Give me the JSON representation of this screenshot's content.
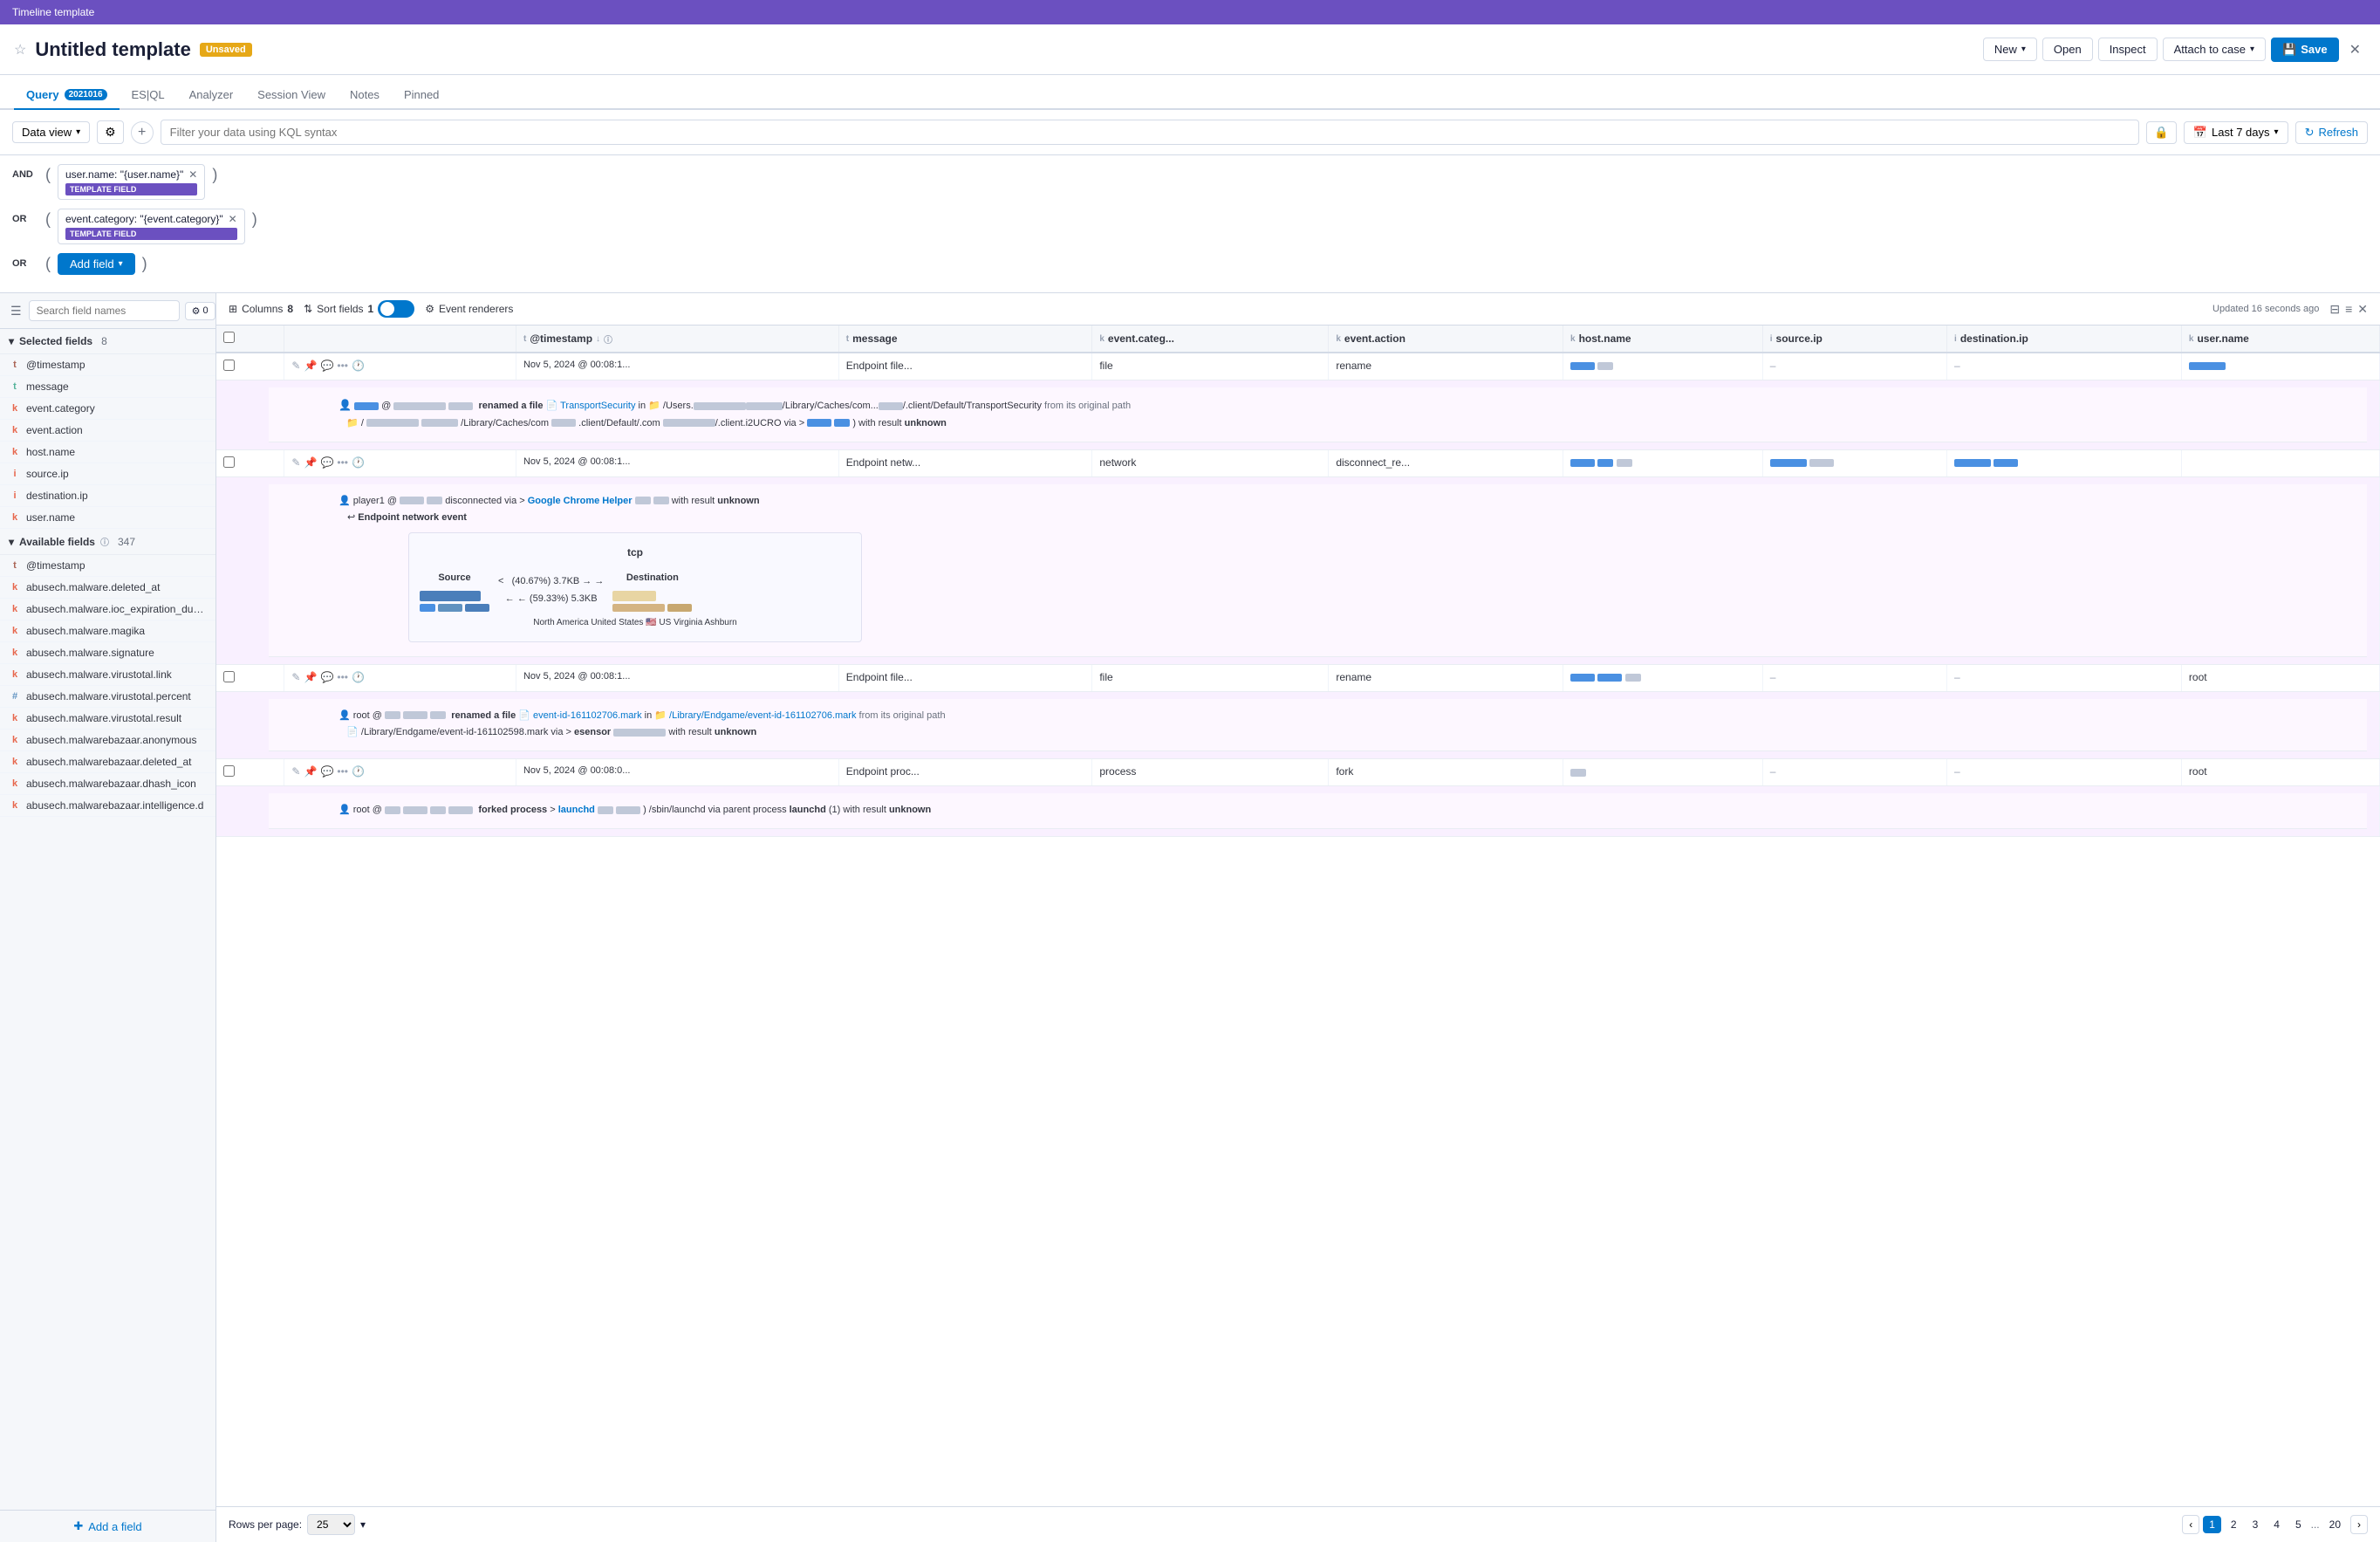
{
  "titleBar": {
    "label": "Timeline template"
  },
  "header": {
    "title": "Untitled template",
    "badge": "Unsaved",
    "actions": {
      "new": "New",
      "open": "Open",
      "inspect": "Inspect",
      "attachToCase": "Attach to case",
      "save": "Save"
    }
  },
  "tabs": [
    {
      "id": "query",
      "label": "Query",
      "badge": "2021016",
      "active": true
    },
    {
      "id": "esql",
      "label": "ES|QL",
      "active": false
    },
    {
      "id": "analyzer",
      "label": "Analyzer",
      "active": false
    },
    {
      "id": "sessionView",
      "label": "Session View",
      "active": false
    },
    {
      "id": "notes",
      "label": "Notes",
      "active": false
    },
    {
      "id": "pinned",
      "label": "Pinned",
      "active": false
    }
  ],
  "queryBar": {
    "dataViewLabel": "Data view",
    "placeholder": "Filter your data using KQL syntax",
    "dateRange": "Last 7 days",
    "refresh": "Refresh"
  },
  "filters": [
    {
      "op": "AND",
      "paren_left": "(",
      "value": "user.name: \"{user.name}\"",
      "badge": "TEMPLATE FIELD",
      "paren_right": ")"
    },
    {
      "op": "OR",
      "paren_left": "(",
      "value": "event.category: \"{event.category}\"",
      "badge": "TEMPLATE FIELD",
      "paren_right": ")"
    },
    {
      "op": "OR",
      "paren_left": "(",
      "addField": "Add field",
      "paren_right": ")"
    }
  ],
  "sidebar": {
    "searchPlaceholder": "Search field names",
    "filterCount": "0",
    "selectedFields": {
      "label": "Selected fields",
      "count": 8,
      "fields": [
        {
          "name": "@timestamp",
          "type": "date"
        },
        {
          "name": "message",
          "type": "text"
        },
        {
          "name": "event.category",
          "type": "keyword"
        },
        {
          "name": "event.action",
          "type": "keyword"
        },
        {
          "name": "host.name",
          "type": "keyword"
        },
        {
          "name": "source.ip",
          "type": "ip"
        },
        {
          "name": "destination.ip",
          "type": "ip"
        },
        {
          "name": "user.name",
          "type": "keyword"
        }
      ]
    },
    "availableFields": {
      "label": "Available fields",
      "count": 347,
      "fields": [
        {
          "name": "@timestamp",
          "type": "date"
        },
        {
          "name": "abusech.malware.deleted_at",
          "type": "keyword"
        },
        {
          "name": "abusech.malware.ioc_expiration_duration",
          "type": "keyword"
        },
        {
          "name": "abusech.malware.magika",
          "type": "keyword"
        },
        {
          "name": "abusech.malware.signature",
          "type": "keyword"
        },
        {
          "name": "abusech.malware.virustotal.link",
          "type": "keyword"
        },
        {
          "name": "abusech.malware.virustotal.percent",
          "type": "number"
        },
        {
          "name": "abusech.malware.virustotal.result",
          "type": "keyword"
        },
        {
          "name": "abusech.malwarebazaar.anonymous",
          "type": "keyword"
        },
        {
          "name": "abusech.malwarebazaar.deleted_at",
          "type": "keyword"
        },
        {
          "name": "abusech.malwarebazaar.dhash_icon",
          "type": "keyword"
        },
        {
          "name": "abusech.malwarebazaar.intelligence.d",
          "type": "keyword"
        }
      ]
    },
    "addFieldLabel": "Add a field"
  },
  "columnsBar": {
    "columns": "Columns",
    "columnsCount": 8,
    "sortFields": "Sort fields",
    "sortCount": 1,
    "eventRenderers": "Event renderers",
    "updated": "Updated 16 seconds ago"
  },
  "tableHeaders": [
    {
      "id": "checkbox",
      "label": ""
    },
    {
      "id": "actions",
      "label": ""
    },
    {
      "id": "timestamp",
      "label": "@timestamp",
      "type": "date",
      "sortable": true
    },
    {
      "id": "message",
      "label": "message",
      "type": "text"
    },
    {
      "id": "eventcategory",
      "label": "event.categ...",
      "type": "keyword"
    },
    {
      "id": "eventaction",
      "label": "event.action",
      "type": "keyword"
    },
    {
      "id": "hostname",
      "label": "host.name",
      "type": "keyword"
    },
    {
      "id": "sourceip",
      "label": "source.ip",
      "type": "ip"
    },
    {
      "id": "destip",
      "label": "destination.ip",
      "type": "ip"
    },
    {
      "id": "username",
      "label": "user.name",
      "type": "keyword"
    }
  ],
  "tableRows": [
    {
      "timestamp": "Nov 5, 2024 @ 00:08:1...",
      "message": "Endpoint file...",
      "category": "file",
      "action": "rename",
      "hostname": "",
      "sourceip": "–",
      "destip": "–",
      "username": ""
    },
    {
      "timestamp": "Nov 5, 2024 @ 00:08:1...",
      "message": "Endpoint netw...",
      "category": "network",
      "action": "disconnect_re...",
      "hostname": "",
      "sourceip": "",
      "destip": "",
      "username": ""
    },
    {
      "timestamp": "Nov 5, 2024 @ 00:08:1...",
      "message": "Endpoint file...",
      "category": "file",
      "action": "rename",
      "hostname": "",
      "sourceip": "–",
      "destip": "–",
      "username": "root"
    },
    {
      "timestamp": "Nov 5, 2024 @ 00:08:0...",
      "message": "Endpoint proc...",
      "category": "process",
      "action": "fork",
      "hostname": "",
      "sourceip": "–",
      "destip": "–",
      "username": "root"
    }
  ],
  "expandedRow1": {
    "actor": "user",
    "action": "renamed a file",
    "app": "TransportSecurity",
    "path": "/Users/.../Library/Caches/com.../.client/Default/TransportSecurity",
    "note": "from its original path",
    "result": "unknown"
  },
  "expandedRow2": {
    "actor": "player1",
    "action": "disconnected via",
    "app": "Google Chrome Helper",
    "result": "unknown",
    "title": "Endpoint network event",
    "protocol": "tcp",
    "source_label": "Source",
    "dest_label": "Destination",
    "flow1_pct": "(40.67%) 3.7KB →",
    "flow2_pct": "← (59.33%) 5.3KB",
    "location": "North America United States 🇺🇸 US Virginia Ashburn"
  },
  "expandedRow3": {
    "actor": "root",
    "action": "renamed a file",
    "app1": "event-id-161102706.mark",
    "path": "/Library/Endgame/event-id-161102706.mark",
    "note": "from its original path",
    "app2": "event-id-161102598.mark",
    "via": "esensor",
    "result": "unknown"
  },
  "expandedRow4": {
    "actor": "root",
    "action": "forked process",
    "app": "launchd",
    "path": "/sbin/launchd",
    "note": "via parent process",
    "parent": "launchd",
    "pid": "(1)",
    "result": "unknown"
  },
  "pagination": {
    "rowsPerPage": "Rows per page: 25",
    "currentPage": 1,
    "pages": [
      "1",
      "2",
      "3",
      "4",
      "5",
      "...",
      "20"
    ]
  }
}
